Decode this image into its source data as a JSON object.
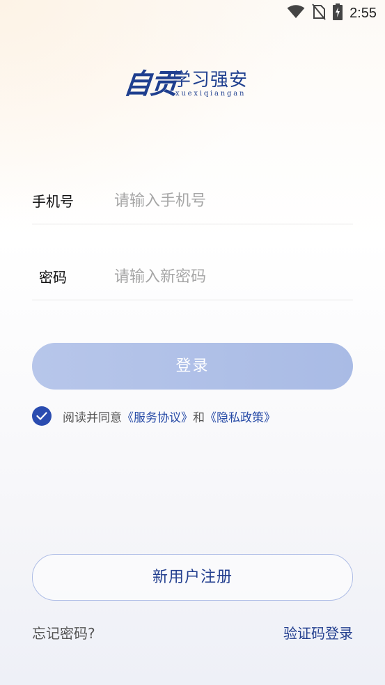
{
  "status_bar": {
    "time": "2:55",
    "icons": [
      "wifi-icon",
      "no-sim-icon",
      "battery-charging-icon"
    ]
  },
  "logo": {
    "calligraphy": "自贡",
    "text": "学习强安",
    "pinyin": "xuexiqiangan"
  },
  "form": {
    "phone_label": "手机号",
    "phone_placeholder": "请输入手机号",
    "phone_value": "",
    "password_label": "密码",
    "password_placeholder": "请输入新密码",
    "password_value": ""
  },
  "login_button": "登录",
  "agreement": {
    "checked": true,
    "prefix": "阅读并同意",
    "service_link": "《服务协议》",
    "conjunction": "和",
    "privacy_link": "《隐私政策》"
  },
  "register_button": "新用户注册",
  "forgot_password": "忘记密码?",
  "sms_login": "验证码登录",
  "colors": {
    "brand": "#233f8f",
    "login_button": "#b2c2e8",
    "checkbox": "#2a4cb0"
  }
}
